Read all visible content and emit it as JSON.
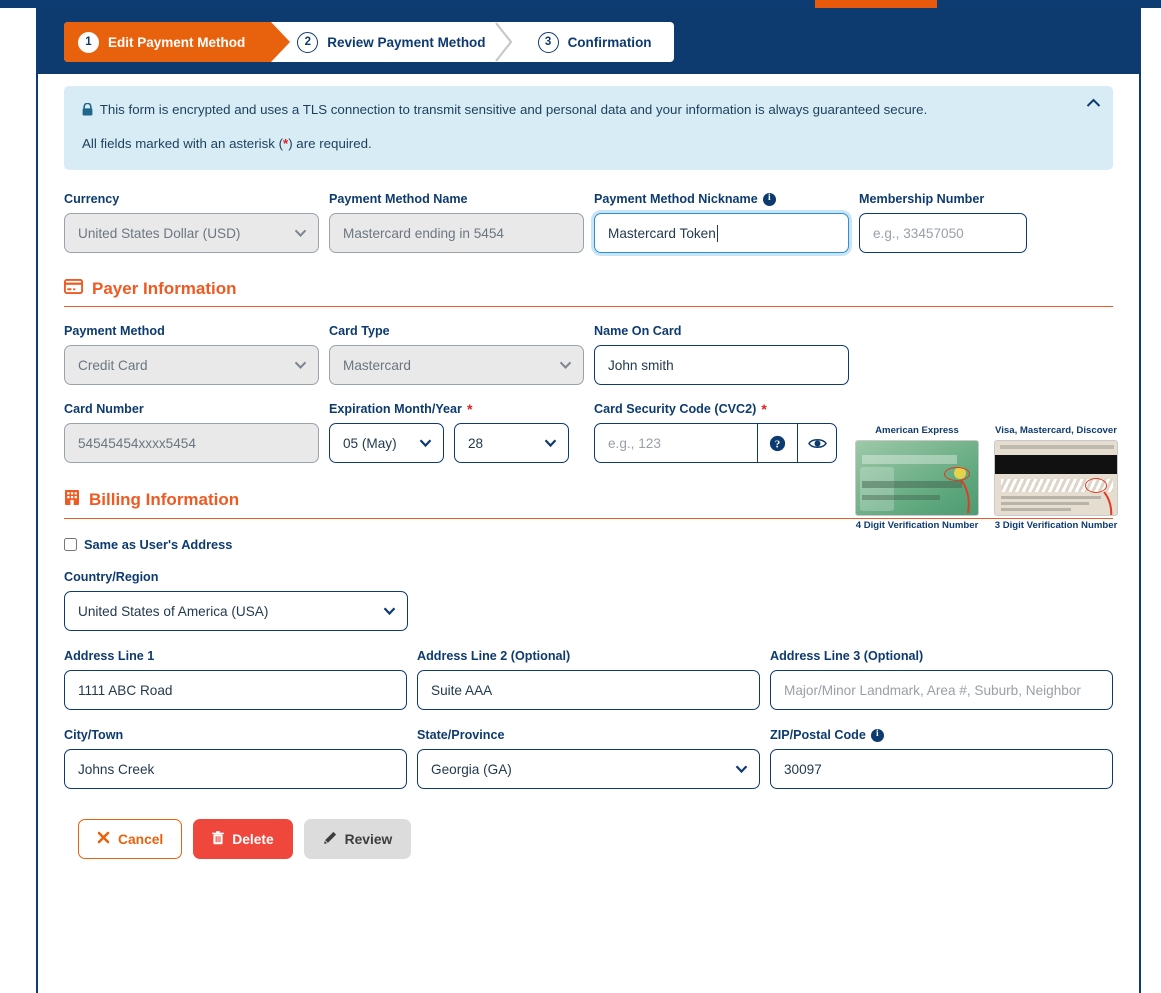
{
  "stepper": {
    "steps": [
      {
        "num": "1",
        "label": "Edit Payment Method",
        "state": "active"
      },
      {
        "num": "2",
        "label": "Review Payment Method",
        "state": "inactive"
      },
      {
        "num": "3",
        "label": "Confirmation",
        "state": "inactive"
      }
    ]
  },
  "notice": {
    "line1": "This form is encrypted and uses a TLS connection to transmit sensitive and personal data and your information is always guaranteed secure.",
    "line2_prefix": "All fields marked with an asterisk (",
    "line2_star": "*",
    "line2_suffix": ") are required.",
    "lock_icon": "lock-icon",
    "collapse_icon": "chevron-up-icon"
  },
  "top_row": {
    "currency": {
      "label": "Currency",
      "value": "United States Dollar (USD)",
      "disabled": true
    },
    "payment_method_name": {
      "label": "Payment Method Name",
      "value": "Mastercard ending in 5454",
      "disabled": true
    },
    "nickname": {
      "label": "Payment Method Nickname",
      "value": "Mastercard Token",
      "info_icon": "info-icon",
      "focused": true
    },
    "membership_number": {
      "label": "Membership Number",
      "placeholder": "e.g., 33457050",
      "value": ""
    }
  },
  "payer": {
    "heading": "Payer Information",
    "heading_icon": "credit-card-icon",
    "payment_method": {
      "label": "Payment Method",
      "value": "Credit Card",
      "disabled": true
    },
    "card_type": {
      "label": "Card Type",
      "value": "Mastercard",
      "disabled": true
    },
    "name_on_card": {
      "label": "Name On Card",
      "value": "John smith"
    },
    "card_number": {
      "label": "Card Number",
      "value": "54545454xxxx5454",
      "disabled": true
    },
    "expiration": {
      "label": "Expiration Month/Year",
      "required": "*",
      "month": "05 (May)",
      "year": "28"
    },
    "cvc": {
      "label": "Card Security Code (CVC2)",
      "required": "*",
      "placeholder": "e.g., 123",
      "value": "",
      "help_icon": "question-circle-icon",
      "reveal_icon": "eye-icon"
    }
  },
  "card_samples": [
    {
      "title": "American Express",
      "caption": "4 Digit Verification Number",
      "image": "amex-card-front-image"
    },
    {
      "title": "Visa, Mastercard, Discover",
      "caption": "3 Digit Verification Number",
      "image": "card-back-image"
    }
  ],
  "billing": {
    "heading": "Billing Information",
    "heading_icon": "building-icon",
    "same_as_user": {
      "label": "Same as User's Address",
      "checked": false
    },
    "country": {
      "label": "Country/Region",
      "value": "United States of America (USA)"
    },
    "address1": {
      "label": "Address Line 1",
      "value": "1111 ABC Road"
    },
    "address2": {
      "label": "Address Line 2 (Optional)",
      "value": "Suite AAA"
    },
    "address3": {
      "label": "Address Line 3 (Optional)",
      "placeholder": "Major/Minor Landmark, Area #, Suburb, Neighbor",
      "value": ""
    },
    "city": {
      "label": "City/Town",
      "value": "Johns Creek"
    },
    "state": {
      "label": "State/Province",
      "value": "Georgia (GA)"
    },
    "zip": {
      "label": "ZIP/Postal Code",
      "value": "30097",
      "info_icon": "info-icon"
    }
  },
  "actions": {
    "cancel": {
      "label": "Cancel",
      "icon": "x-icon"
    },
    "delete": {
      "label": "Delete",
      "icon": "trash-icon"
    },
    "review": {
      "label": "Review",
      "icon": "pencil-icon"
    }
  },
  "colors": {
    "navy": "#0e3b6f",
    "orange": "#e8620d",
    "section_orange": "#f05a22",
    "notice_bg": "#d7ecf5",
    "delete_red": "#f0473c",
    "required_red": "#e02020"
  }
}
